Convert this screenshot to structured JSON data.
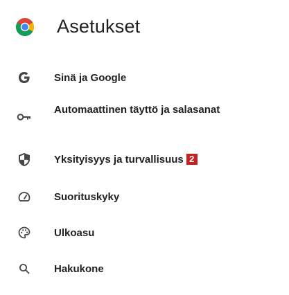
{
  "header": {
    "title": "Asetukset",
    "logo_icon": "chrome-logo-icon"
  },
  "menu": {
    "items": [
      {
        "label": "Sinä ja Google",
        "icon": "google-g-icon"
      },
      {
        "label": "Automaattinen täyttö ja salasanat",
        "icon": "key-icon"
      },
      {
        "label": "Yksityisyys ja turvallisuus",
        "icon": "shield-icon",
        "badge": "2"
      },
      {
        "label": "Suorituskyky",
        "icon": "speedometer-icon"
      },
      {
        "label": "Ulkoasu",
        "icon": "palette-icon"
      },
      {
        "label": "Hakukone",
        "icon": "search-icon"
      }
    ]
  },
  "colors": {
    "text": "#1f1f1f",
    "badge_bg": "#c5221f",
    "badge_text": "#ffffff",
    "icon": "#444746"
  }
}
